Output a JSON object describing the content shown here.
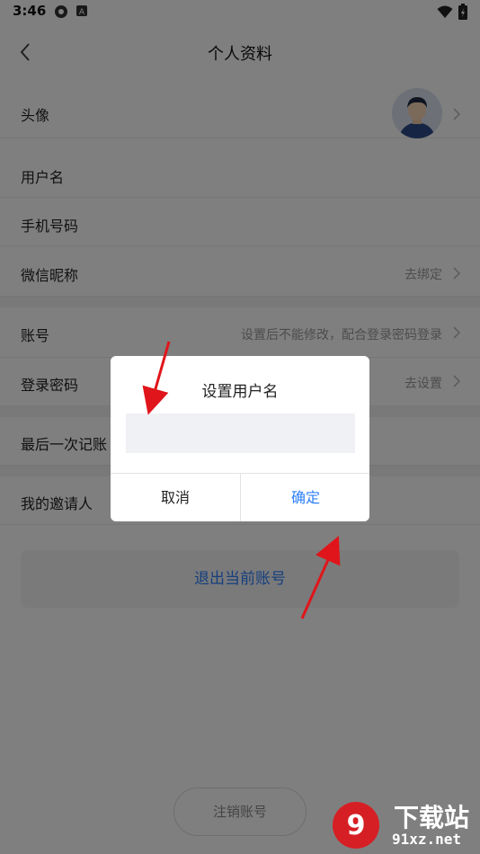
{
  "status_bar": {
    "time": "3:46"
  },
  "header": {
    "title": "个人资料"
  },
  "rows": [
    {
      "label": "头像"
    },
    {
      "label": "用户名"
    },
    {
      "label": "手机号码"
    },
    {
      "label": "微信昵称",
      "value": "去绑定"
    },
    {
      "label": "账号",
      "value": "设置后不能修改，配合登录密码登录"
    },
    {
      "label": "登录密码",
      "value": "去设置"
    },
    {
      "label": "最后一次记账"
    },
    {
      "label": "我的邀请人"
    }
  ],
  "logout_button": "退出当前账号",
  "deregister_button": "注销账号",
  "dialog": {
    "title": "设置用户名",
    "input_value": "",
    "cancel": "取消",
    "confirm": "确定"
  },
  "watermark": {
    "brand": "下载站",
    "url": "91xz.net"
  },
  "colors": {
    "accent": "#2d7ff9",
    "annotation_arrow": "#e0151b"
  }
}
